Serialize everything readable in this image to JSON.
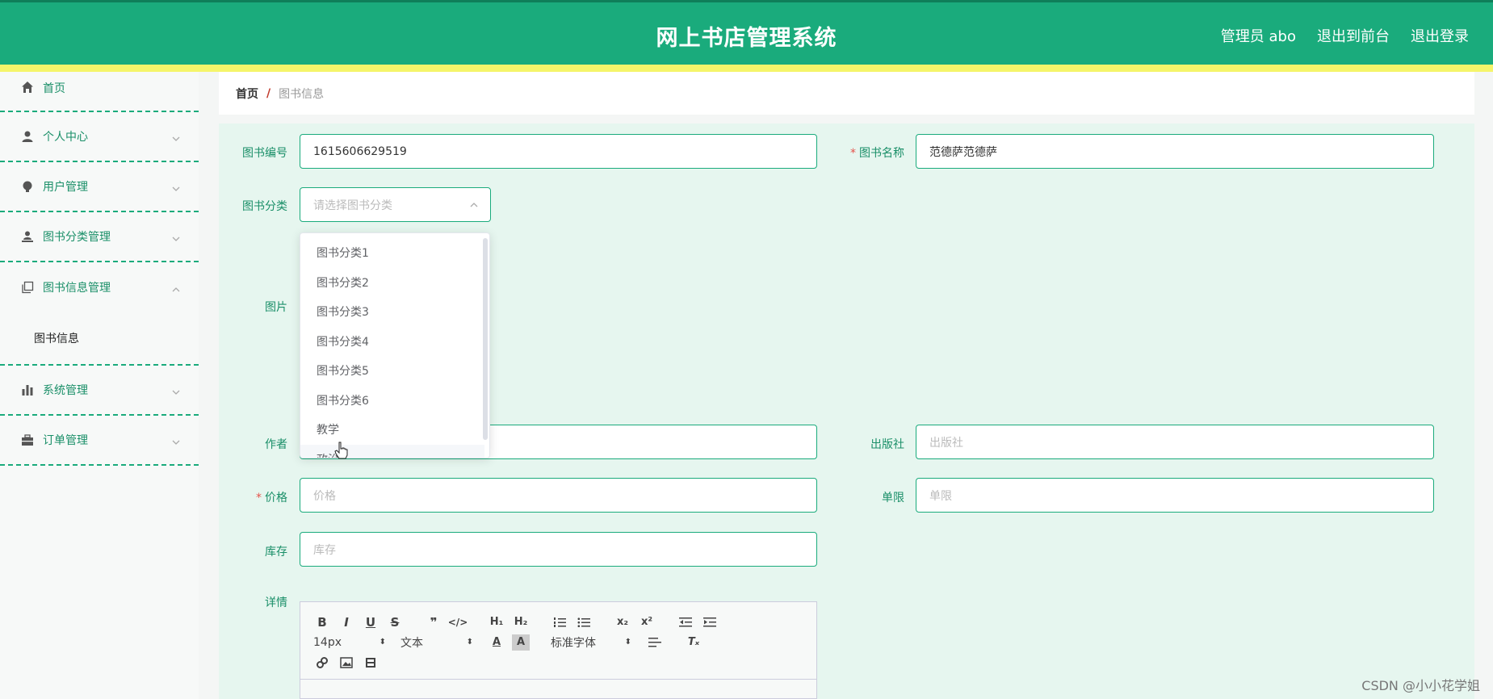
{
  "header": {
    "title": "网上书店管理系统",
    "links": [
      "管理员 abo",
      "退出到前台",
      "退出登录"
    ]
  },
  "sidebar": {
    "items": [
      {
        "label": "首页",
        "icon": "home-icon"
      },
      {
        "label": "个人中心",
        "icon": "user-icon"
      },
      {
        "label": "用户管理",
        "icon": "bulb-icon"
      },
      {
        "label": "图书分类管理",
        "icon": "person-desk-icon"
      },
      {
        "label": "图书信息管理",
        "icon": "copy-icon",
        "open": true,
        "children": [
          "图书信息"
        ]
      },
      {
        "label": "系统管理",
        "icon": "bar-chart-icon"
      },
      {
        "label": "订单管理",
        "icon": "briefcase-icon"
      }
    ]
  },
  "breadcrumb": {
    "home": "首页",
    "separator": "/",
    "current": "图书信息"
  },
  "form": {
    "book_no": {
      "label": "图书编号",
      "value": "1615606629519"
    },
    "book_name": {
      "label": "图书名称",
      "required": "*",
      "value": "范德萨范德萨"
    },
    "category": {
      "label": "图书分类",
      "placeholder": "请选择图书分类"
    },
    "image": {
      "label": "图片"
    },
    "author": {
      "label": "作者"
    },
    "publisher": {
      "label": "出版社",
      "placeholder": "出版社"
    },
    "price": {
      "label": "价格",
      "required": "*",
      "placeholder": "价格"
    },
    "limit": {
      "label": "单限",
      "placeholder": "单限"
    },
    "stock": {
      "label": "库存",
      "placeholder": "库存"
    },
    "detail": {
      "label": "详情"
    }
  },
  "dropdown": {
    "options": [
      "图书分类1",
      "图书分类2",
      "图书分类3",
      "图书分类4",
      "图书分类5",
      "图书分类6",
      "教学",
      "政治"
    ]
  },
  "editor": {
    "font_size": "14px",
    "text_type": "文本",
    "font_family": "标准字体"
  },
  "watermark": "CSDN @小小花学姐",
  "colors": {
    "primary": "#1aab7c",
    "accent_bar": "#f5f56a",
    "panel_bg": "#e6f6ef"
  }
}
